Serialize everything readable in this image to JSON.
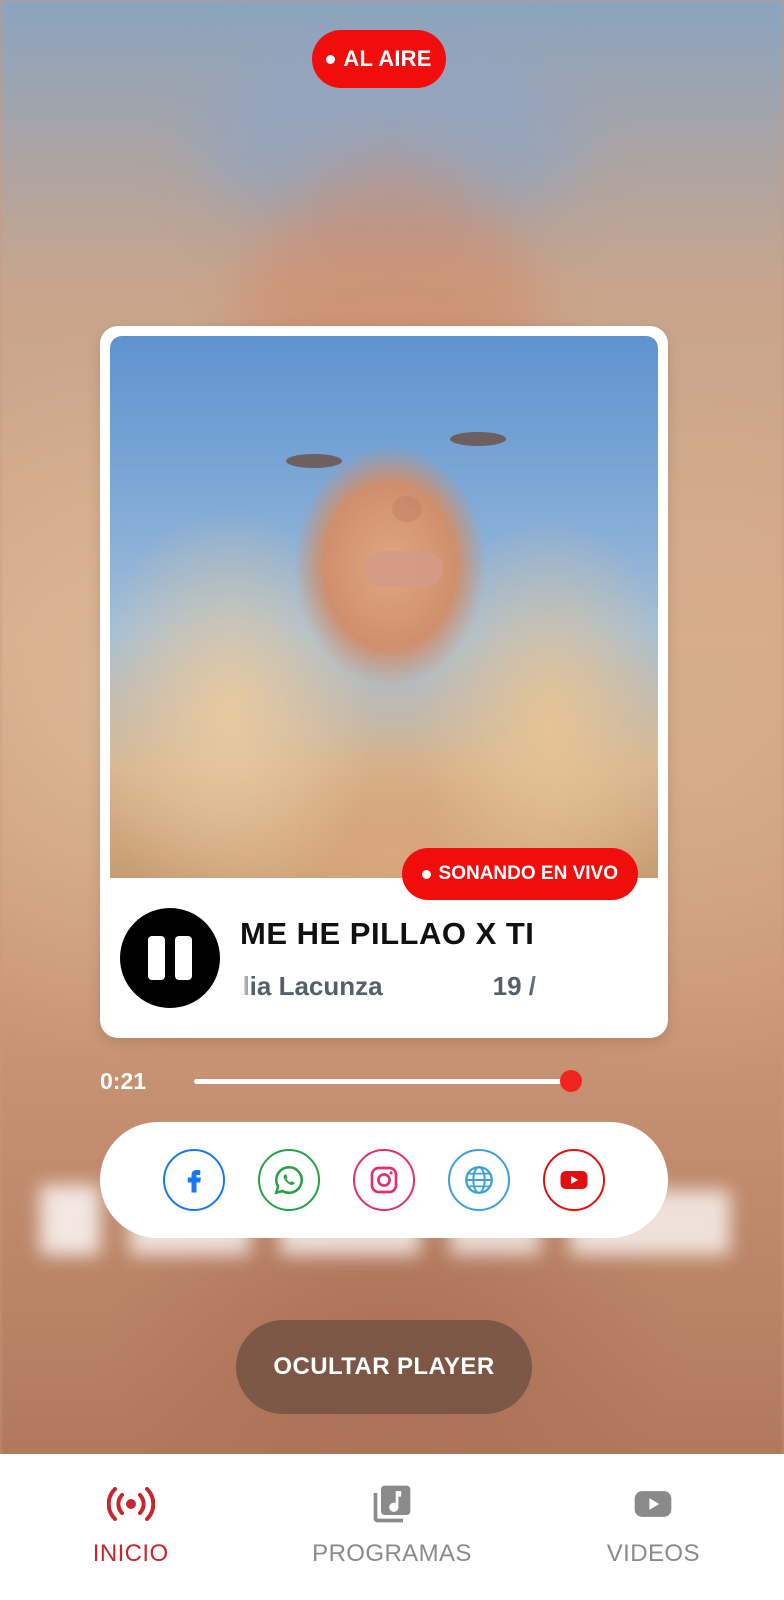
{
  "status": {
    "live_label": "AL AIRE"
  },
  "now_playing": {
    "badge": "SONANDO EN VIVO",
    "title": "ME HE PILLAO X TI",
    "artist": "alia Lacunza",
    "ticker_tail": "19 /",
    "elapsed": "0:21",
    "progress": 0.97,
    "state": "playing",
    "control_icon": "pause-icon"
  },
  "social": [
    {
      "id": "facebook",
      "icon": "facebook-icon",
      "color": "#1877f2"
    },
    {
      "id": "whatsapp",
      "icon": "whatsapp-icon",
      "color": "#25a244"
    },
    {
      "id": "instagram",
      "icon": "instagram-icon",
      "color": "#e1306c"
    },
    {
      "id": "web",
      "icon": "globe-icon",
      "color": "#3ca0d8"
    },
    {
      "id": "youtube",
      "icon": "youtube-icon",
      "color": "#e01010"
    }
  ],
  "actions": {
    "hide_player": "OCULTAR PLAYER"
  },
  "tabs": [
    {
      "label": "INICIO",
      "icon": "radio-broadcast-icon",
      "active": true
    },
    {
      "label": "PROGRAMAS",
      "icon": "music-library-icon",
      "active": false
    },
    {
      "label": "VIDEOS",
      "icon": "youtube-play-icon",
      "active": false
    }
  ],
  "colors": {
    "accent": "#f20d0d",
    "tab_active": "#c8262b",
    "tab_inactive": "#8a8a8a"
  }
}
